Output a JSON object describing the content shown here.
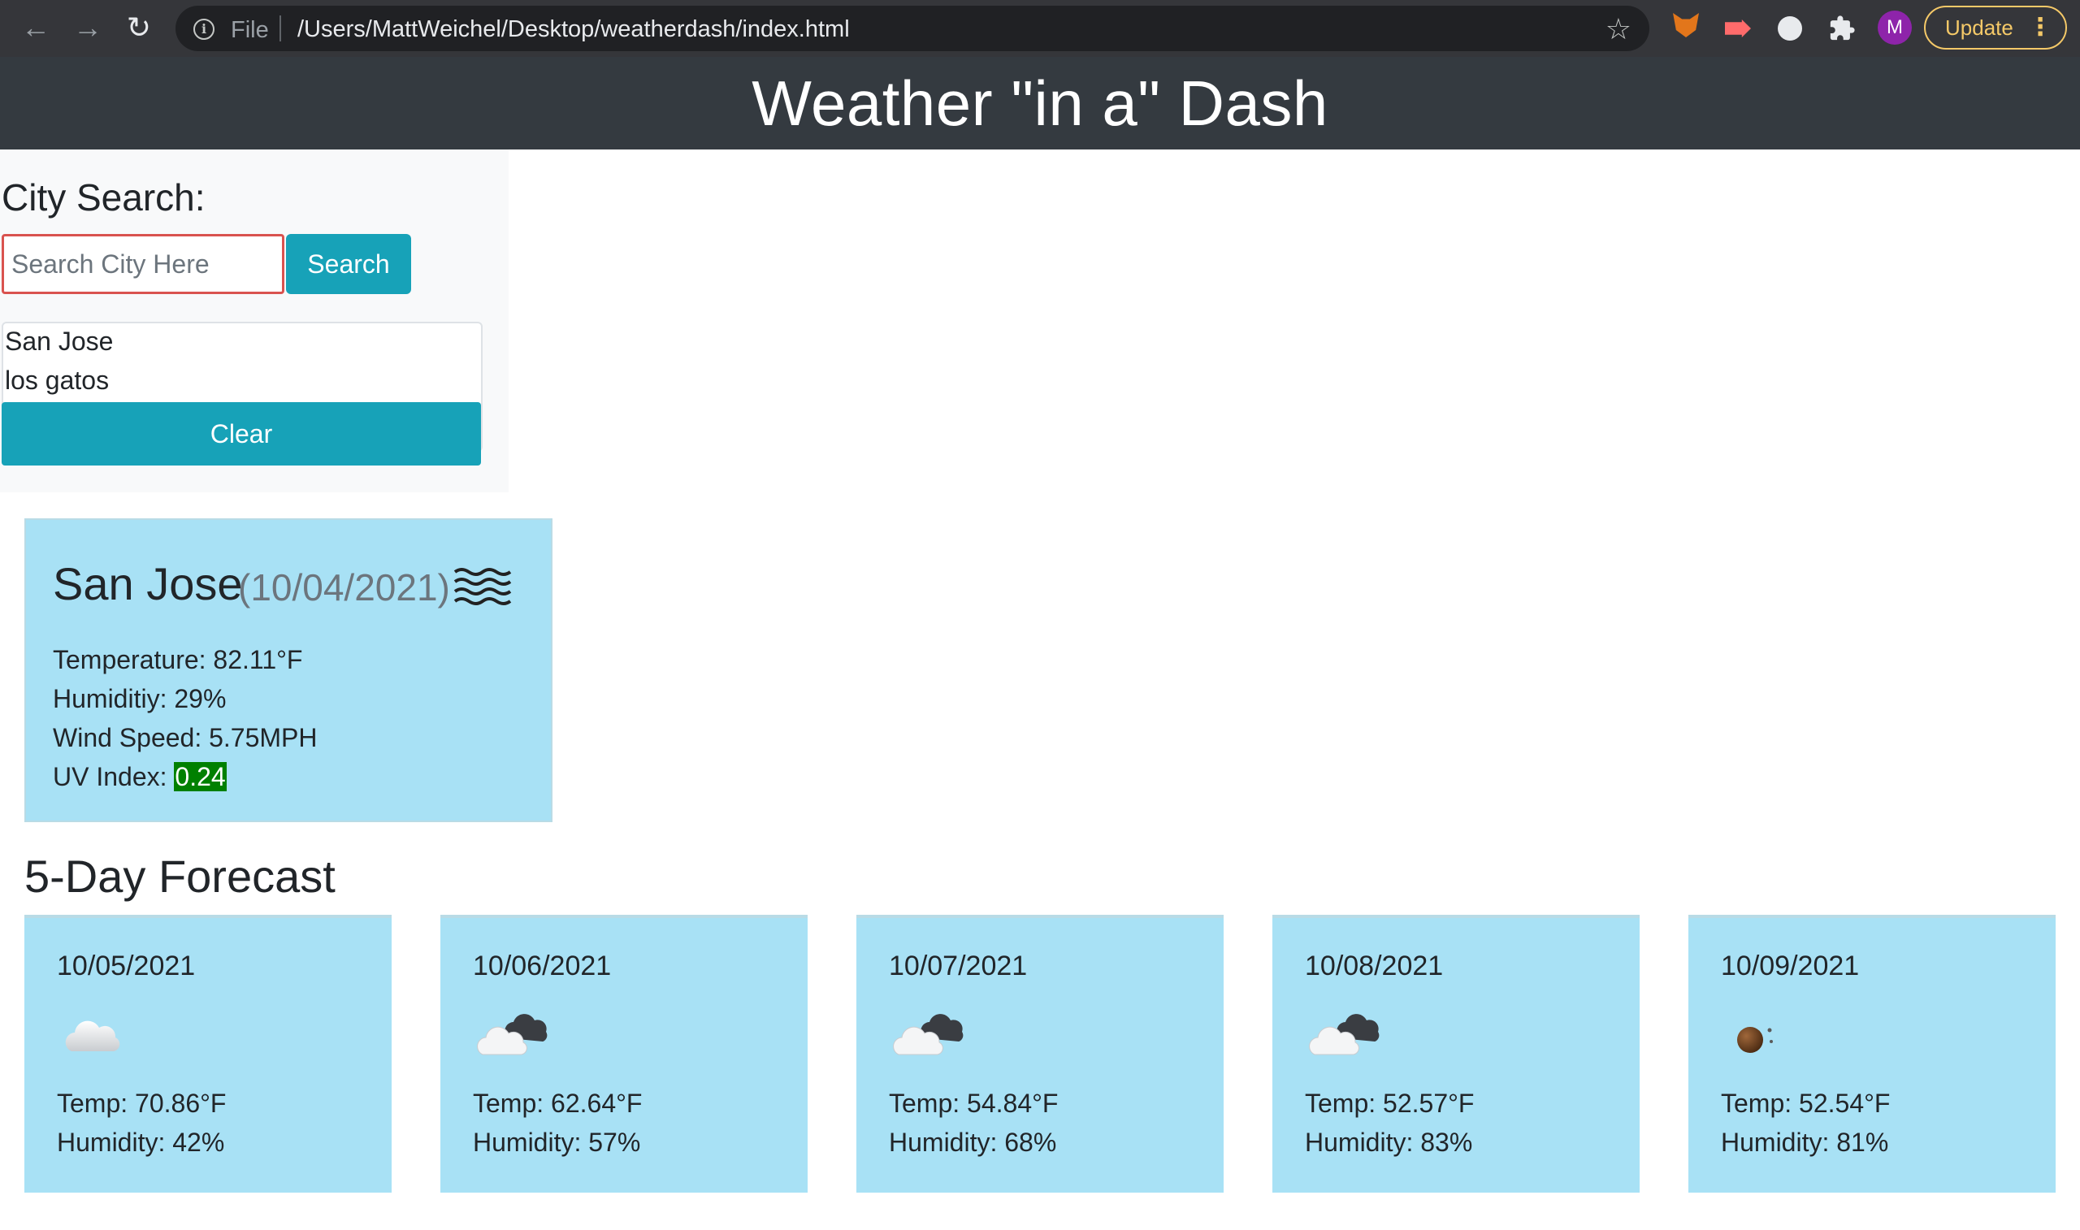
{
  "browser": {
    "file_label": "File",
    "url": "/Users/MattWeichel/Desktop/weatherdash/index.html",
    "avatar_letter": "M",
    "update_label": "Update",
    "icons": [
      "back-arrow-icon",
      "forward-arrow-icon",
      "reload-icon",
      "info-icon",
      "star-icon",
      "metamask-icon",
      "video-extension-icon",
      "circle-extension-icon",
      "puzzle-icon"
    ],
    "avatar_color": "#8e24aa",
    "update_color": "#f5c968"
  },
  "header": {
    "title": "Weather \"in a\" Dash",
    "background": "#343a40"
  },
  "sidebar": {
    "heading": "City Search:",
    "search_placeholder": "Search City Here",
    "search_button": "Search",
    "history": [
      "San Jose",
      "los gatos"
    ],
    "clear_button": "Clear",
    "button_color": "#17a2b8"
  },
  "current": {
    "city": "San Jose",
    "date": "(10/04/2021)",
    "icon": "fog-icon",
    "temperature": "Temperature: 82.11°F",
    "humidity": "Humiditiy: 29%",
    "wind": "Wind Speed: 5.75MPH",
    "uv_label": "UV Index: ",
    "uv_value": "0.24",
    "uv_color": "#008000",
    "card_color": "#a8e1f5"
  },
  "forecast": {
    "title": "5-Day Forecast",
    "days": [
      {
        "date": "10/05/2021",
        "icon": "cloud-icon",
        "temp": "Temp: 70.86°F",
        "humidity": "Humidity: 42%"
      },
      {
        "date": "10/06/2021",
        "icon": "broken-clouds-icon",
        "temp": "Temp: 62.64°F",
        "humidity": "Humidity: 57%"
      },
      {
        "date": "10/07/2021",
        "icon": "broken-clouds-icon",
        "temp": "Temp: 54.84°F",
        "humidity": "Humidity: 68%"
      },
      {
        "date": "10/08/2021",
        "icon": "broken-clouds-icon",
        "temp": "Temp: 52.57°F",
        "humidity": "Humidity: 83%"
      },
      {
        "date": "10/09/2021",
        "icon": "clear-night-icon",
        "temp": "Temp: 52.54°F",
        "humidity": "Humidity: 81%"
      }
    ]
  }
}
